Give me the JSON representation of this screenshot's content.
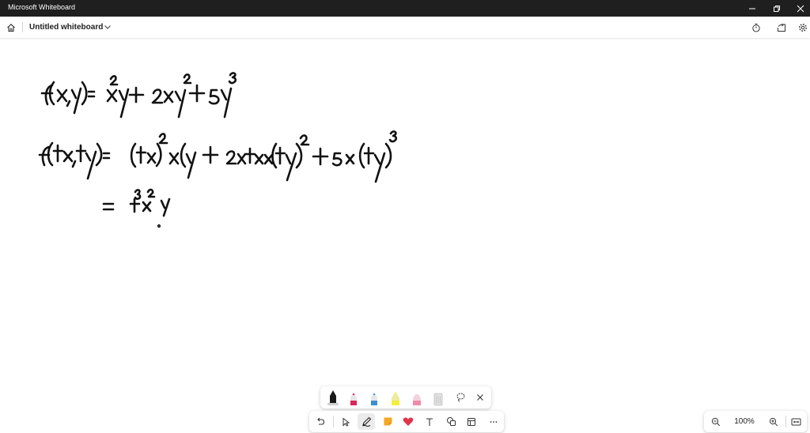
{
  "window": {
    "title": "Microsoft Whiteboard"
  },
  "appbar": {
    "board_title": "Untitled whiteboard"
  },
  "zoom": {
    "level": "100%"
  },
  "pens": [
    {
      "name": "black-pen",
      "color": "#1a1a1a",
      "selected": true
    },
    {
      "name": "red-pen",
      "color": "#d6265a"
    },
    {
      "name": "blue-pen",
      "color": "#3a8fd0"
    },
    {
      "name": "highlighter-yellow",
      "color": "#f4ef3c"
    },
    {
      "name": "highlighter-pink",
      "color": "#f08aa8"
    },
    {
      "name": "eraser",
      "color": "#d9d9d9"
    }
  ],
  "toolbar_tools": [
    "undo-icon",
    "select-icon",
    "pen-icon",
    "sticky-note-icon",
    "reaction-heart-icon",
    "text-icon",
    "shapes-icon",
    "template-icon",
    "more-icon"
  ],
  "colors": {
    "titlebar": "#1f1f1f",
    "ink": "#111111",
    "sticky_note": "#f5a623",
    "heart": "#e0344a"
  }
}
